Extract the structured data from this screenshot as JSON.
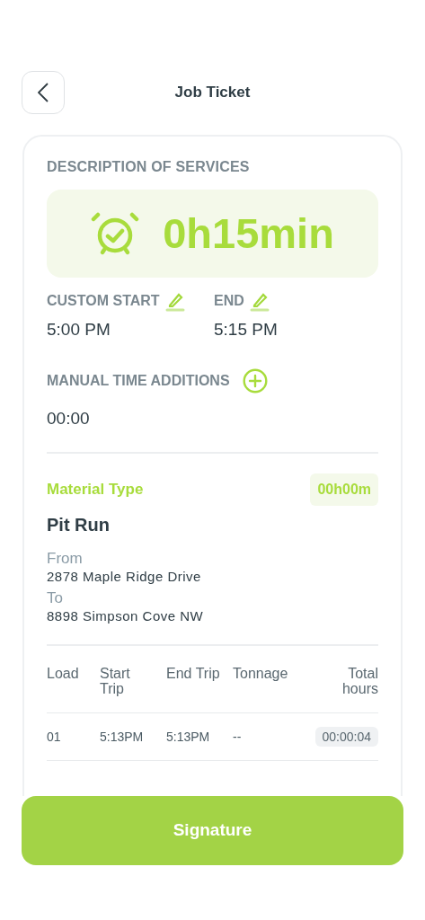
{
  "header": {
    "title": "Job Ticket"
  },
  "section_title": "DESCRIPTION OF SERVICES",
  "duration": "0h15min",
  "custom_start": {
    "label": "CUSTOM START",
    "value": "5:00 PM"
  },
  "end": {
    "label": "END",
    "value": "5:15 PM"
  },
  "manual_time_additions": {
    "label": "MANUAL TIME ADDITIONS",
    "value": "00:00"
  },
  "material": {
    "label": "Material Type",
    "time": "00h00m",
    "name": "Pit Run",
    "from_label": "From",
    "from": "2878 Maple Ridge Drive",
    "to_label": "To",
    "to": "8898 Simpson Cove NW"
  },
  "table": {
    "columns": [
      "Load",
      "Start Trip",
      "End Trip",
      "Tonnage",
      "Total hours"
    ],
    "rows": [
      {
        "load": "01",
        "start": "5:13PM",
        "end": "5:13PM",
        "tonnage": "--",
        "total": "00:00:04"
      }
    ]
  },
  "button": "Signature"
}
